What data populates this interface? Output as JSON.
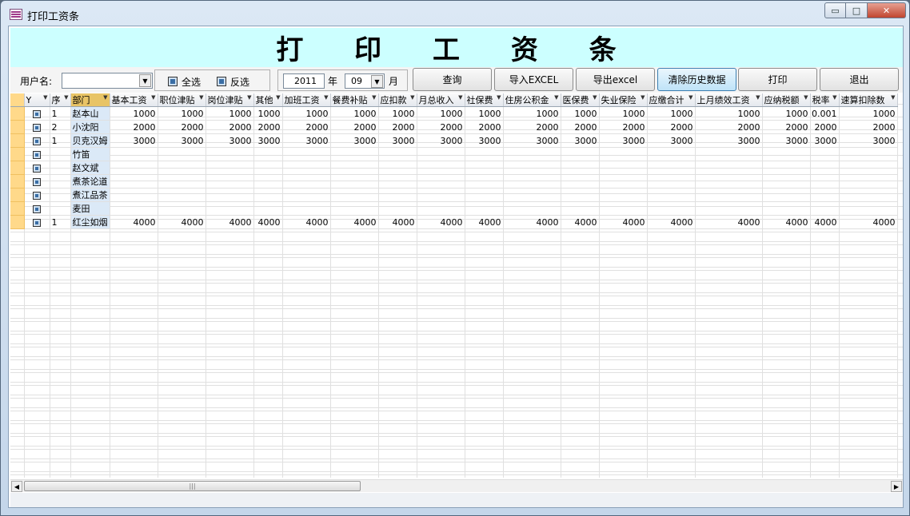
{
  "window": {
    "title": "打印工资条",
    "min_glyph": "▭",
    "max_glyph": "□",
    "close_glyph": "✕"
  },
  "header": {
    "title": "打 印 工 资 条"
  },
  "toolbar": {
    "user_label": "用户名:",
    "user_value": "",
    "select_all": "全选",
    "invert": "反选",
    "year": "2011",
    "year_label": "年",
    "month": "09",
    "month_label": "月",
    "buttons": {
      "query": "查询",
      "import": "导入EXCEL",
      "export": "导出excel",
      "clear": "清除历史数据",
      "print": "打印",
      "exit": "退出"
    }
  },
  "grid": {
    "headers": [
      "Y",
      "序",
      "部门",
      "基本工资",
      "职位津贴",
      "岗位津贴",
      "其他",
      "加班工资",
      "餐费补贴",
      "应扣款",
      "月总收入",
      "社保费",
      "住房公积金",
      "医保费",
      "失业保险",
      "应缴合计",
      "上月绩效工资",
      "应纳税额",
      "税率",
      "速算扣除数"
    ],
    "rows": [
      {
        "idx": "1",
        "name": "赵本山",
        "vals": [
          "1000",
          "1000",
          "1000",
          "1000",
          "1000",
          "1000",
          "1000",
          "1000",
          "1000",
          "1000",
          "1000",
          "1000",
          "1000",
          "1000",
          "1000",
          "0.001",
          "1000"
        ]
      },
      {
        "idx": "2",
        "name": "小沈阳",
        "vals": [
          "2000",
          "2000",
          "2000",
          "2000",
          "2000",
          "2000",
          "2000",
          "2000",
          "2000",
          "2000",
          "2000",
          "2000",
          "2000",
          "2000",
          "2000",
          "2000",
          "2000"
        ]
      },
      {
        "idx": "1",
        "name": "贝克汉姆",
        "vals": [
          "3000",
          "3000",
          "3000",
          "3000",
          "3000",
          "3000",
          "3000",
          "3000",
          "3000",
          "3000",
          "3000",
          "3000",
          "3000",
          "3000",
          "3000",
          "3000",
          "3000"
        ]
      },
      {
        "idx": "",
        "name": "竹笛",
        "vals": [
          "",
          "",
          "",
          "",
          "",
          "",
          "",
          "",
          "",
          "",
          "",
          "",
          "",
          "",
          "",
          "",
          ""
        ]
      },
      {
        "idx": "",
        "name": "赵文斌",
        "vals": [
          "",
          "",
          "",
          "",
          "",
          "",
          "",
          "",
          "",
          "",
          "",
          "",
          "",
          "",
          "",
          "",
          ""
        ]
      },
      {
        "idx": "",
        "name": "煮茶论道",
        "vals": [
          "",
          "",
          "",
          "",
          "",
          "",
          "",
          "",
          "",
          "",
          "",
          "",
          "",
          "",
          "",
          "",
          ""
        ]
      },
      {
        "idx": "",
        "name": "煮江品茶",
        "vals": [
          "",
          "",
          "",
          "",
          "",
          "",
          "",
          "",
          "",
          "",
          "",
          "",
          "",
          "",
          "",
          "",
          ""
        ]
      },
      {
        "idx": "",
        "name": "麦田",
        "vals": [
          "",
          "",
          "",
          "",
          "",
          "",
          "",
          "",
          "",
          "",
          "",
          "",
          "",
          "",
          "",
          "",
          ""
        ]
      },
      {
        "idx": "1",
        "name": "红尘如烟",
        "vals": [
          "4000",
          "4000",
          "4000",
          "4000",
          "4000",
          "4000",
          "4000",
          "4000",
          "4000",
          "4000",
          "4000",
          "4000",
          "4000",
          "4000",
          "4000",
          "4000",
          "4000"
        ]
      }
    ]
  },
  "scroll": {
    "left": "◀",
    "right": "▶",
    "grip": "|||"
  }
}
